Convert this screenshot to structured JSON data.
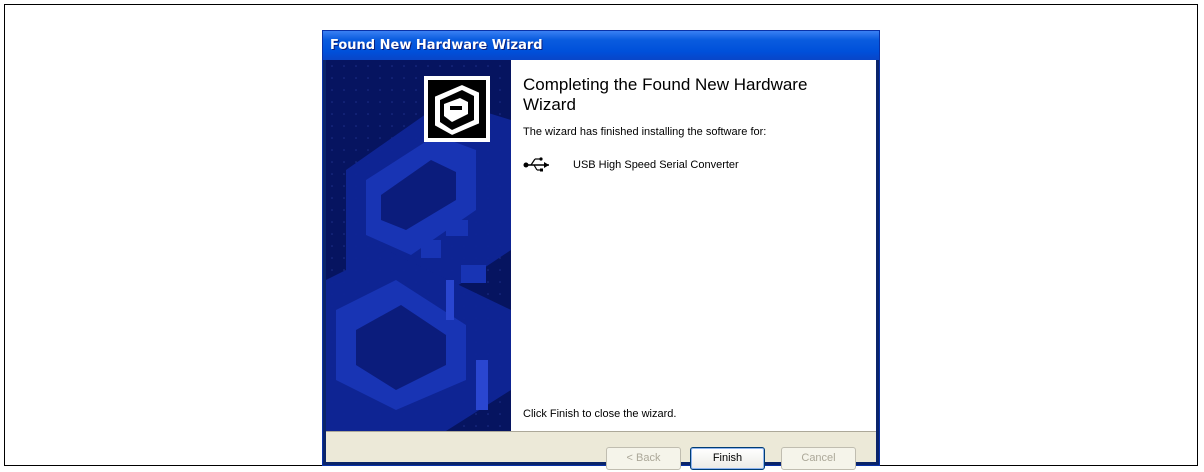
{
  "window": {
    "title": "Found New Hardware Wizard"
  },
  "content": {
    "heading": "Completing the Found New Hardware Wizard",
    "intro": "The wizard has finished installing the software for:",
    "device_icon": "usb-icon",
    "device_name": "USB High Speed Serial Converter",
    "footer": "Click Finish to close the wizard."
  },
  "side_panel": {
    "icon": "hardware-drive-icon"
  },
  "buttons": {
    "back": "< Back",
    "finish": "Finish",
    "cancel": "Cancel"
  },
  "colors": {
    "titlebar": "#0054e3",
    "side_panel": "#061460",
    "dialog_face": "#ece9d8"
  }
}
